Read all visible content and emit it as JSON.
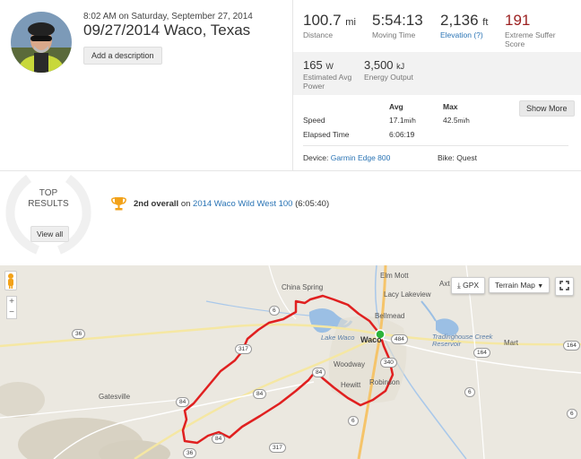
{
  "header": {
    "datetime": "8:02 AM on Saturday, September 27, 2014",
    "title": "09/27/2014 Waco, Texas",
    "add_description": "Add a description"
  },
  "stats": {
    "distance": {
      "value": "100.7",
      "unit": "mi",
      "label": "Distance"
    },
    "moving_time": {
      "value": "5:54:13",
      "label": "Moving Time"
    },
    "elevation": {
      "value": "2,136",
      "unit": "ft",
      "label": "Elevation (?)"
    },
    "suffer_score": {
      "value": "191",
      "label": "Extreme Suffer Score"
    },
    "avg_power": {
      "value": "165",
      "unit": "W",
      "label": "Estimated Avg Power"
    },
    "energy": {
      "value": "3,500",
      "unit": "kJ",
      "label": "Energy Output"
    }
  },
  "table": {
    "headers": {
      "avg": "Avg",
      "max": "Max"
    },
    "speed": {
      "label": "Speed",
      "avg": "17.1",
      "avg_unit": "mi/h",
      "max": "42.5",
      "max_unit": "mi/h"
    },
    "elapsed": {
      "label": "Elapsed Time",
      "avg": "6:06:19"
    },
    "show_more": "Show More"
  },
  "device": {
    "label": "Device:",
    "value": "Garmin Edge 800"
  },
  "bike": {
    "label": "Bike:",
    "value": "Quest"
  },
  "results": {
    "title_line1": "TOP",
    "title_line2": "RESULTS",
    "view_all": "View all",
    "rank": "2nd overall",
    "on": "on",
    "event": "2014 Waco Wild West 100",
    "time": "(6:05:40)"
  },
  "map": {
    "gpx": "GPX",
    "terrain": "Terrain Map",
    "zoom_in": "+",
    "zoom_out": "−",
    "labels": {
      "elm_mott": "Elm Mott",
      "china_spring": "China Spring",
      "lacy_lakeview": "Lacy Lakeview",
      "bellmead": "Bellmead",
      "waco": "Waco",
      "lake_waco": "Lake Waco",
      "woodway": "Woodway",
      "hewitt": "Hewitt",
      "robinson": "Robinson",
      "gatesville": "Gatesville",
      "tradinghouse": "Tradinghouse Creek Reservoir",
      "mart": "Mart",
      "axtell": "Axt"
    },
    "shields": [
      "6",
      "36",
      "317",
      "84",
      "84",
      "84",
      "6",
      "484",
      "340",
      "164",
      "6",
      "164",
      "6",
      "317",
      "84",
      "36"
    ],
    "route_color": "#e02020",
    "start_color": "#2db33a"
  }
}
